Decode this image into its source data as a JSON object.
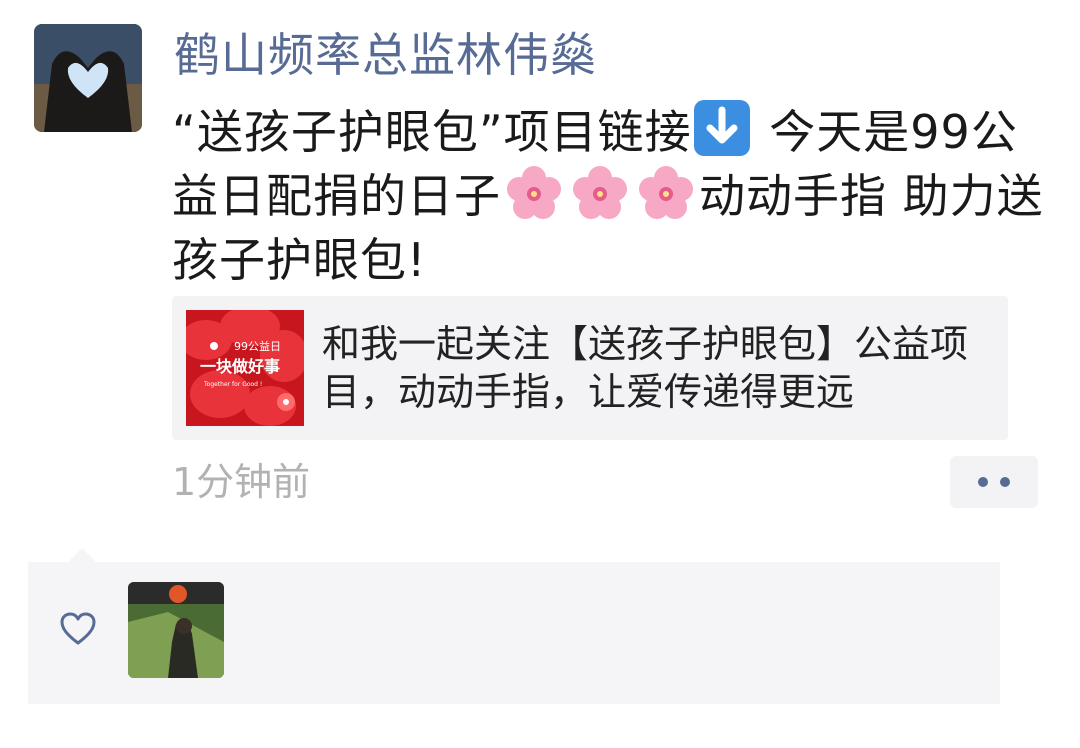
{
  "post": {
    "username": "鹤山频率总监林伟燊",
    "content_part1": "“送孩子护眼包”项目链接",
    "content_part2": " 今天是99公益日配捐的日子",
    "content_part3": "动动手指 助力送孩子护眼包!",
    "emoji_icons": [
      "arrow-down-icon",
      "cherry-blossom-icon",
      "cherry-blossom-icon",
      "cherry-blossom-icon"
    ],
    "link": {
      "title": "和我一起关注【送孩子护眼包】公益项目，动动手指，让爱传递得更远",
      "thumb_text_top": "99公益日",
      "thumb_text_main": "一块做好事",
      "thumb_text_sub": "Together for Good !"
    },
    "time": "1分钟前"
  },
  "colors": {
    "name_blue": "#576b95",
    "time_gray": "#b2b2b2",
    "card_bg": "#f3f3f5"
  }
}
